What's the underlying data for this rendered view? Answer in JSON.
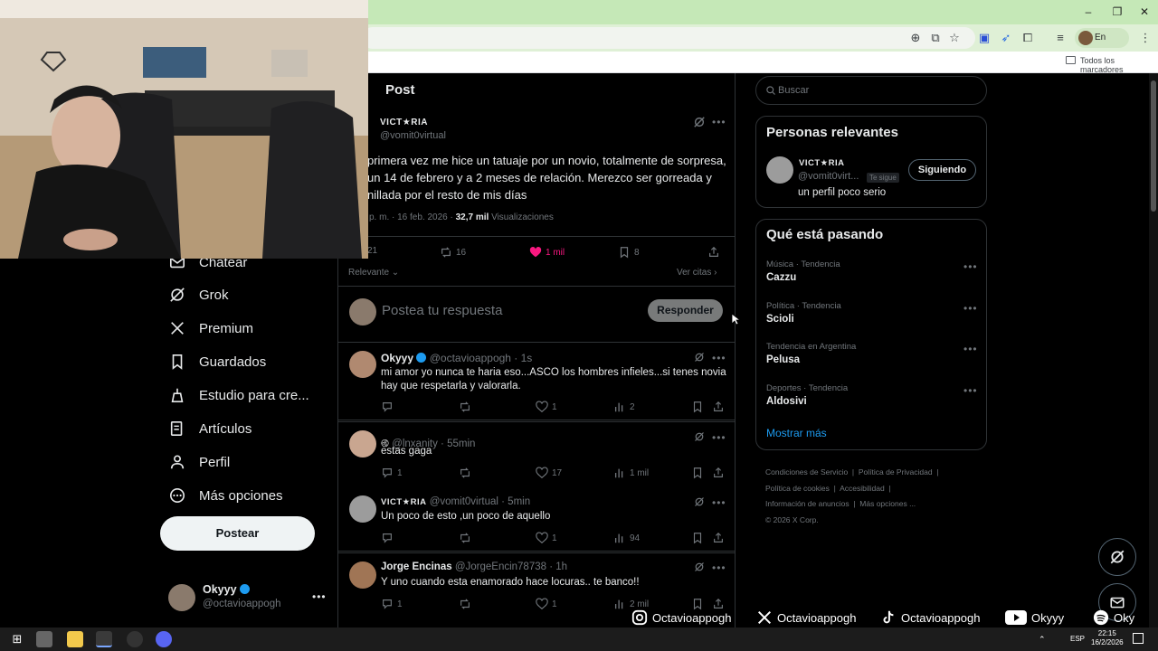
{
  "browser": {
    "pause_label": "En pausa",
    "bookmarks_label": "Todos los marcadores"
  },
  "header": {
    "title": "Post"
  },
  "post": {
    "author_name": "VICT★RIA",
    "author_handle": "@vomit0virtual",
    "text_line1": "primera vez me hice un tatuaje por un novio, totalmente de sorpresa,",
    "text_line2": "un 14 de febrero y a 2 meses de relación. Merezco ser gorreada y",
    "text_line3": "nillada por el resto de mis días",
    "time_date": "p. m. · 16 feb. 2026 · ",
    "views_count": "32,7 mil",
    "views_label": "Visualizaciones",
    "stats": {
      "replies": "21",
      "reposts": "16",
      "likes": "1 mil",
      "bookmarks": "8"
    }
  },
  "filters": {
    "relevance": "Relevante",
    "quotes": "Ver citas"
  },
  "composer": {
    "placeholder": "Postea tu respuesta",
    "reply_button": "Responder"
  },
  "replies": [
    {
      "name": "Okyyy",
      "handle": "@octavioappogh · 1s",
      "text1": "mi amor yo nunca te haria eso...ASCO los hombres infieles...si tenes novia",
      "text2": "hay que respetarla y valorarla.",
      "replies": "",
      "likes": "1",
      "views": "2"
    },
    {
      "name": "",
      "handle": "@lnxanity · 55min",
      "text1": "estas gaga",
      "text2": "",
      "replies": "1",
      "likes": "17",
      "views": "1 mil"
    },
    {
      "name": "VICT★RIA",
      "handle": "@vomit0virtual · 5min",
      "text1": "Un poco de esto ,un poco de aquello",
      "text2": "",
      "replies": "",
      "likes": "1",
      "views": "94"
    },
    {
      "name": "Jorge Encinas",
      "handle": "@JorgeEncin78738 · 1h",
      "text1": "Y uno cuando esta enamorado hace locuras.. te banco!!",
      "text2": "",
      "replies": "1",
      "likes": "1",
      "views": "2 mil"
    }
  ],
  "nav": [
    {
      "label": "Chatear",
      "icon": "mail-icon"
    },
    {
      "label": "Grok",
      "icon": "grok-icon"
    },
    {
      "label": "Premium",
      "icon": "x-icon"
    },
    {
      "label": "Guardados",
      "icon": "bookmark-icon"
    },
    {
      "label": "Estudio para cre...",
      "icon": "studio-icon"
    },
    {
      "label": "Artículos",
      "icon": "article-icon"
    },
    {
      "label": "Perfil",
      "icon": "person-icon"
    },
    {
      "label": "Más opciones",
      "icon": "more-circle-icon"
    }
  ],
  "post_button": "Postear",
  "account": {
    "name": "Okyyy",
    "handle": "@octavioappogh"
  },
  "search": {
    "placeholder": "Buscar"
  },
  "relevant": {
    "title": "Personas relevantes",
    "name": "VICT★RIA",
    "handle": "@vomit0virt...",
    "follows_you": "Te sigue",
    "follow_button": "Siguiendo",
    "bio": "un perfil poco serio"
  },
  "trends": {
    "title": "Qué está pasando",
    "items": [
      {
        "context": "Música · Tendencia",
        "name": "Cazzu"
      },
      {
        "context": "Política · Tendencia",
        "name": "Scioli"
      },
      {
        "context": "Tendencia en Argentina",
        "name": "Pelusa"
      },
      {
        "context": "Deportes · Tendencia",
        "name": "Aldosivi"
      }
    ],
    "show_more": "Mostrar más"
  },
  "footer_links": {
    "terms": "Condiciones de Servicio",
    "privacy": "Política de Privacidad",
    "cookies": "Política de cookies",
    "accessibility": "Accesibilidad",
    "ads": "Información de anuncios",
    "more": "Más opciones ...",
    "copyright": "© 2026 X Corp."
  },
  "socials": {
    "instagram": "Octavioappogh",
    "x": "Octavioappogh",
    "tiktok": "Octavioappogh",
    "youtube": "Okyyy",
    "spotify": "Oky"
  },
  "taskbar": {
    "lang": "ESP",
    "time": "22:15",
    "date": "16/2/2026"
  },
  "colors": {
    "like_pink": "#f91880",
    "verified_blue": "#1d9bf0",
    "link_blue": "#1d9bf0"
  }
}
